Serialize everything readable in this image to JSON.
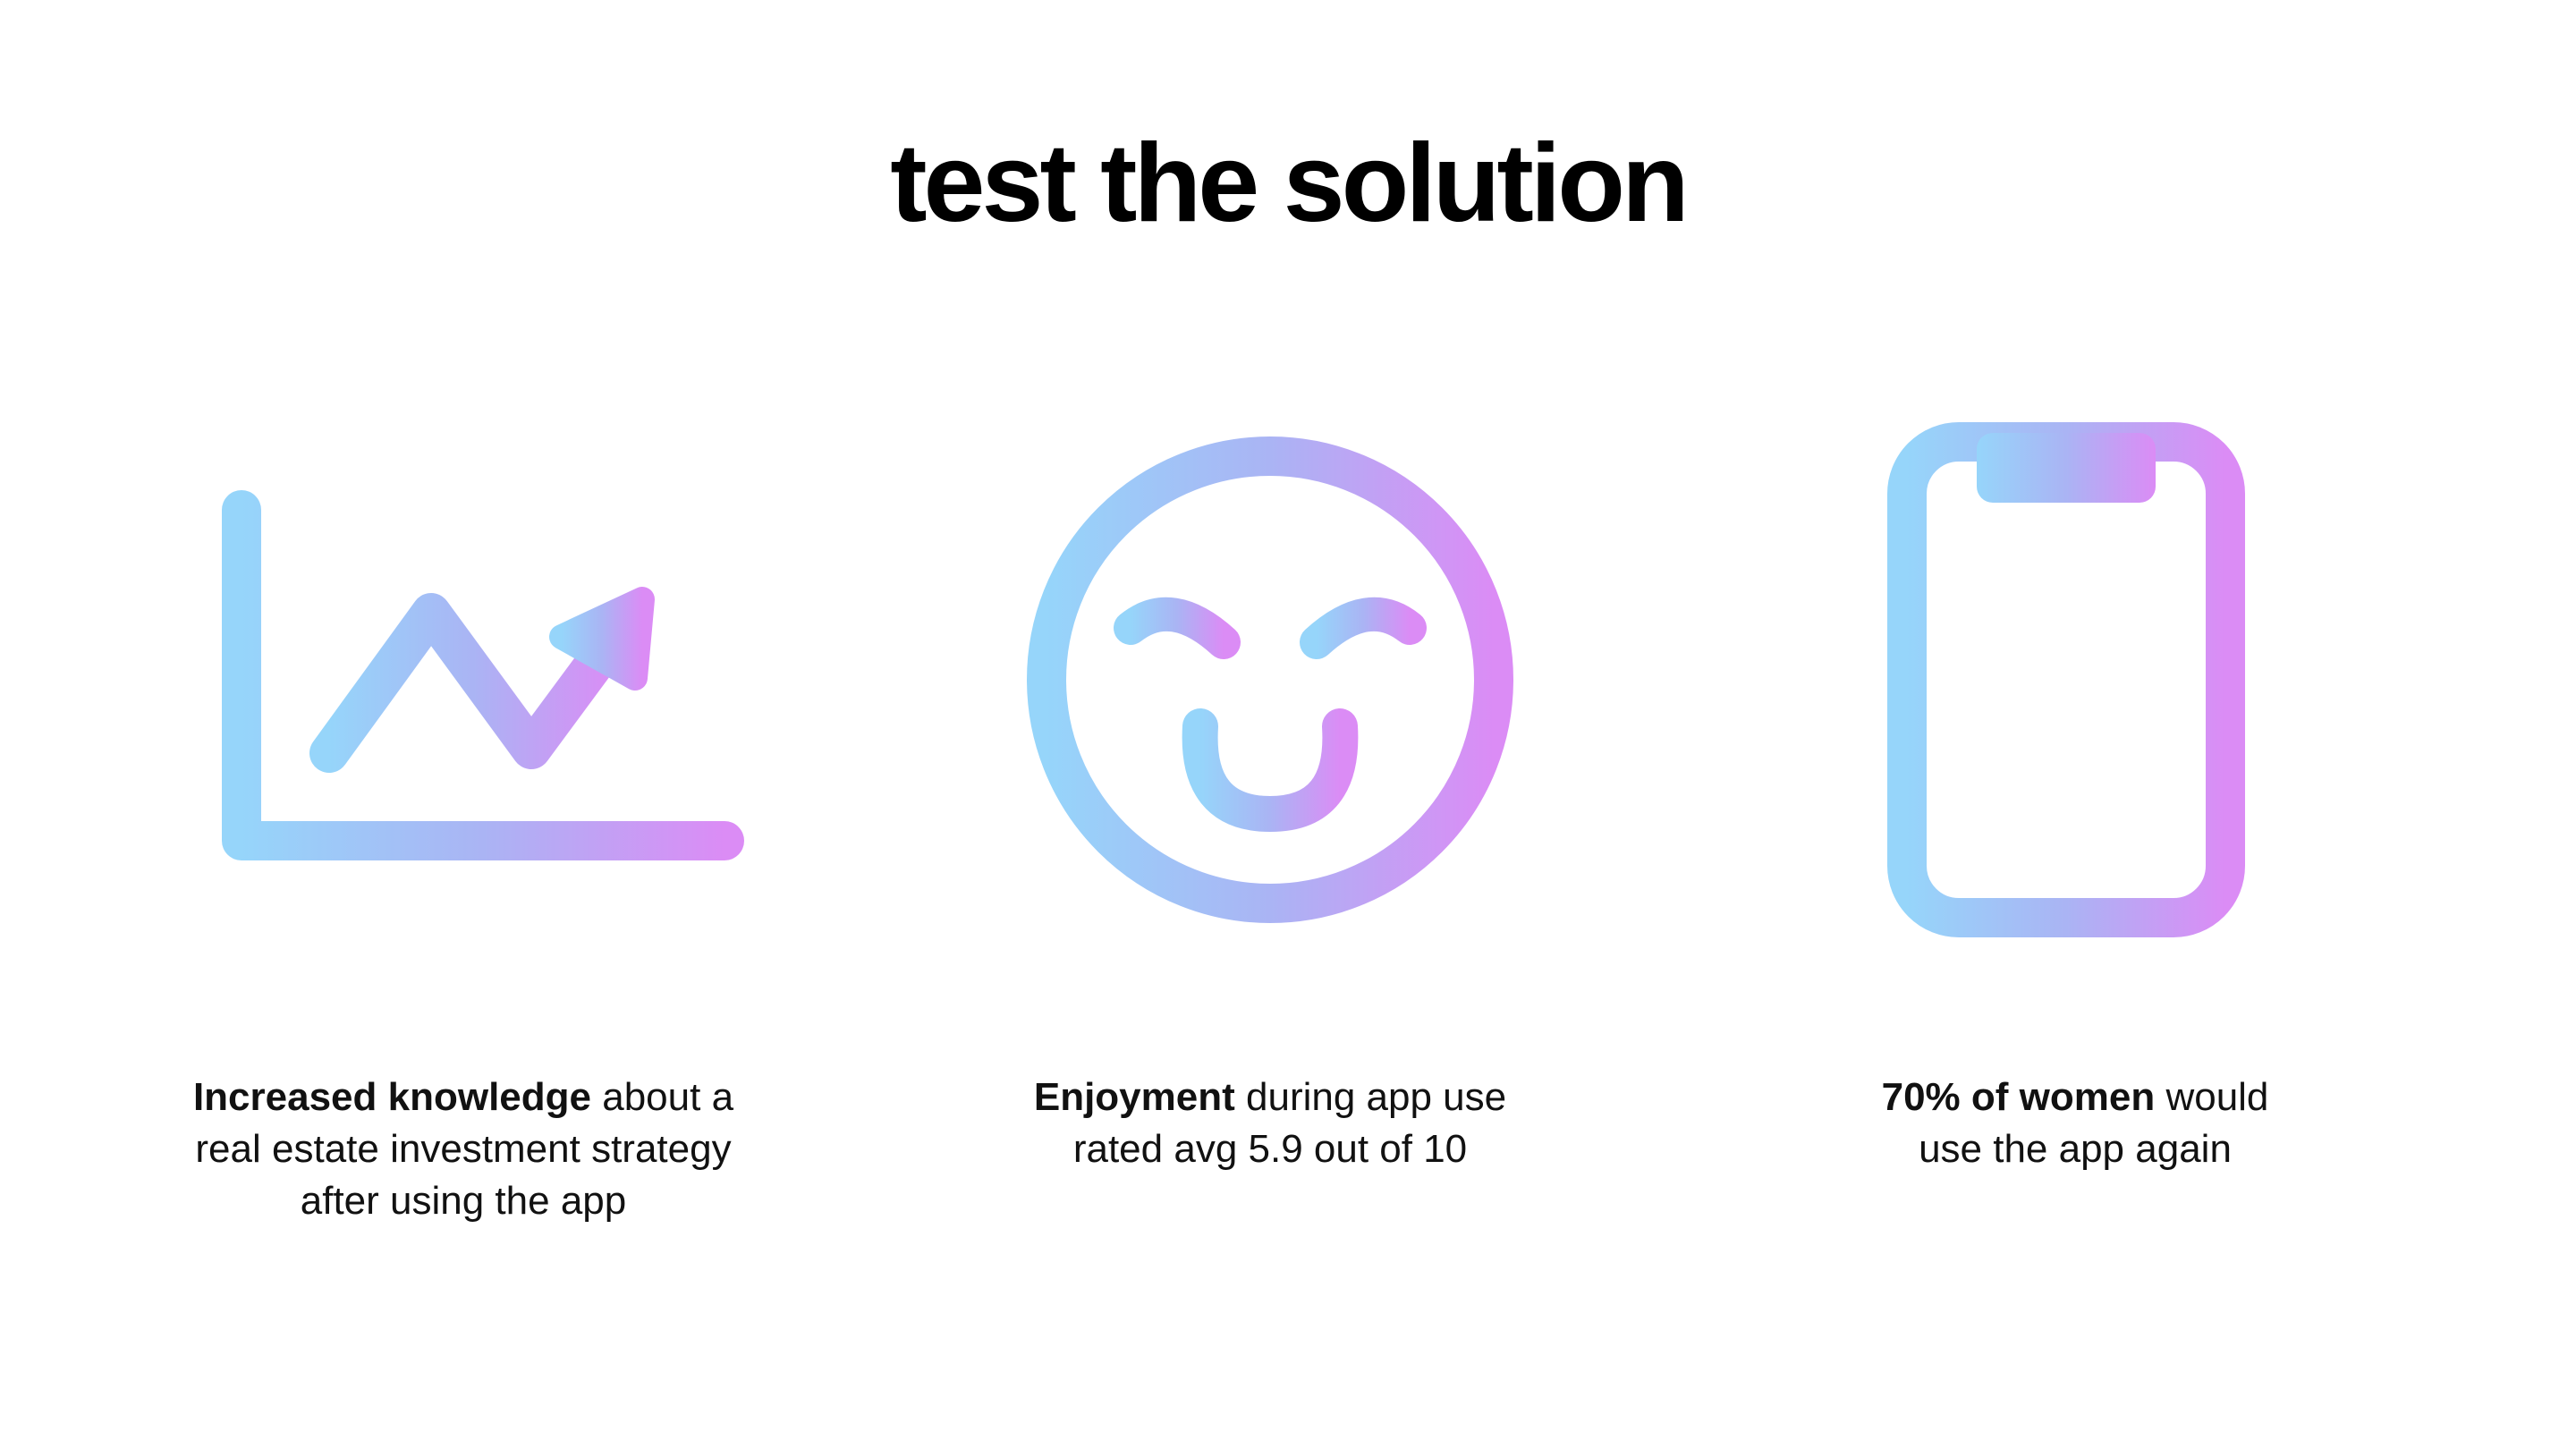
{
  "slide": {
    "title": "test the solution",
    "colors": {
      "gradient_start": "#96d5fa",
      "gradient_mid": "#aab4f4",
      "gradient_end": "#db8cf5",
      "text": "#000000"
    },
    "findings": [
      {
        "icon": "line-chart-trending-up-icon",
        "emphasis": "Increased knowledge",
        "text": " about a real estate investment strategy after using the app"
      },
      {
        "icon": "smiling-face-icon",
        "emphasis": "Enjoyment",
        "text": " during app use rated avg 5.9 out of 10"
      },
      {
        "icon": "smartphone-icon",
        "emphasis": "70% of women",
        "text": " would use the app again"
      }
    ]
  }
}
